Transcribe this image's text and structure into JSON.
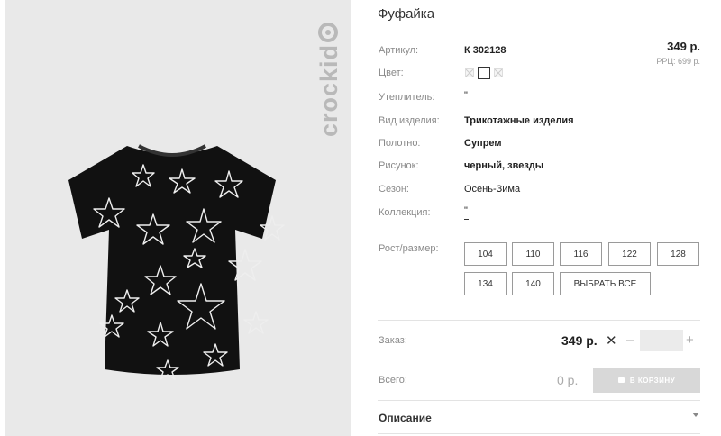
{
  "product": {
    "title": "Фуфайка",
    "brand": "crockid",
    "price": "349 р.",
    "rrp": "РРЦ: 699 р."
  },
  "specs": [
    {
      "label": "Артикул:",
      "value": "К 302128"
    },
    {
      "label": "Цвет:",
      "value": ""
    },
    {
      "label": "Утеплитель:",
      "value": "\""
    },
    {
      "label": "Вид изделия:",
      "value": "Трикотажные изделия"
    },
    {
      "label": "Полотно:",
      "value": "Супрем"
    },
    {
      "label": "Рисунок:",
      "value": "черный, звезды"
    },
    {
      "label": "Сезон:",
      "value": "Осень-Зима"
    },
    {
      "label": "Коллекция:",
      "value": "\""
    },
    {
      "label": "Рост/размер:",
      "value": ""
    }
  ],
  "sizes": [
    "104",
    "110",
    "116",
    "122",
    "128",
    "134",
    "140"
  ],
  "select_all_label": "ВЫБРАТЬ ВСЕ",
  "order": {
    "label": "Заказ:",
    "price": "349 р.",
    "times": "✕",
    "minus": "–",
    "plus": "+",
    "qty_value": "",
    "total_label": "Всего:",
    "total_value": "0 р.",
    "cart_label": "В КОРЗИНУ"
  },
  "description_label": "Описание",
  "icons": {
    "cart": "cart-icon",
    "caret": "chevron-down-icon",
    "brand_mark": "crockid-logo-icon"
  },
  "colors": {
    "accent_disabled": "#d8d8d8",
    "photo_bg": "#e9e9e9",
    "shirt": "#111111"
  }
}
